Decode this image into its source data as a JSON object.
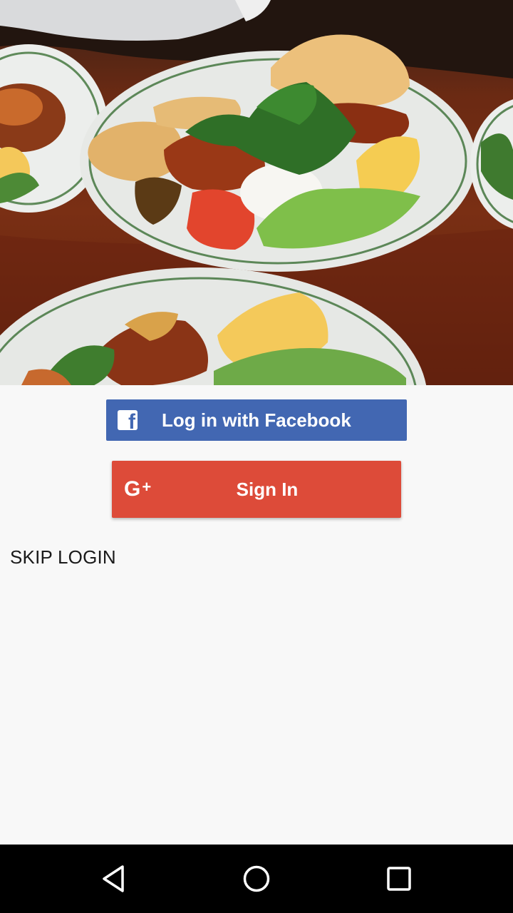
{
  "hero": {
    "image_description_icon": "food-platter-photo"
  },
  "facebook_button": {
    "label": "Log in with Facebook",
    "icon": "facebook-icon",
    "color": "#4267b2"
  },
  "google_button": {
    "label": "Sign In",
    "icon_text": "G",
    "icon_plus": "+",
    "icon": "google-plus-icon",
    "color": "#dd4b39"
  },
  "skip": {
    "label": "SKIP LOGIN"
  },
  "navbar": {
    "back_icon": "back-icon",
    "home_icon": "home-icon",
    "recents_icon": "recents-icon"
  }
}
